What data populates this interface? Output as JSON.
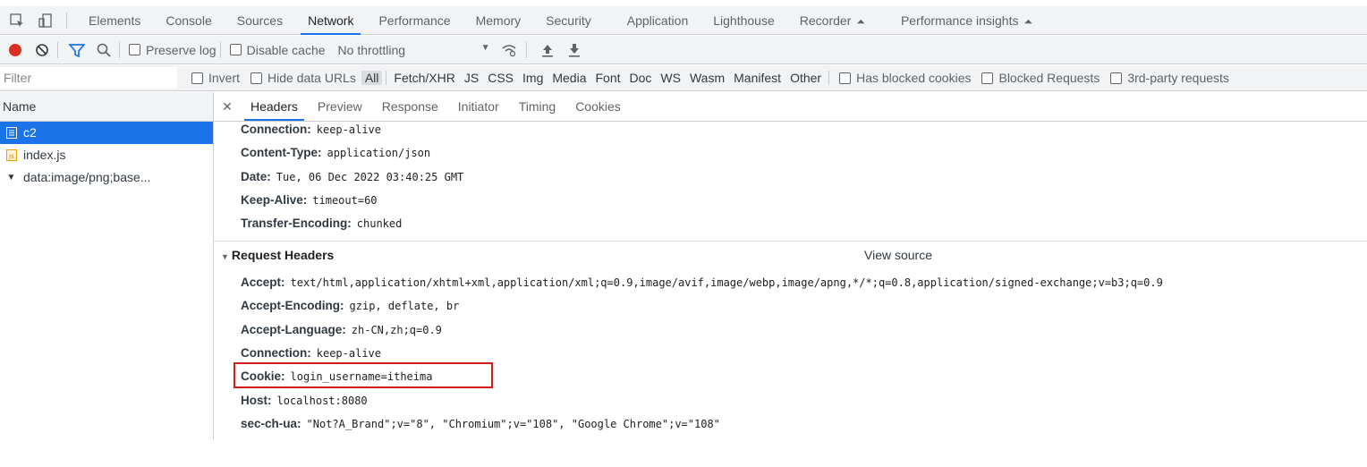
{
  "tabs": [
    "Elements",
    "Console",
    "Sources",
    "Network",
    "Performance",
    "Memory",
    "Security",
    "Application",
    "Lighthouse",
    "Recorder",
    "Performance insights"
  ],
  "active_tab": "Network",
  "toolbar": {
    "preserve_log": "Preserve log",
    "disable_cache": "Disable cache",
    "throttling": "No throttling",
    "record_color": "#d93025"
  },
  "filter": {
    "placeholder": "Filter",
    "invert": "Invert",
    "hide_data_urls": "Hide data URLs",
    "types": [
      "All",
      "Fetch/XHR",
      "JS",
      "CSS",
      "Img",
      "Media",
      "Font",
      "Doc",
      "WS",
      "Wasm",
      "Manifest",
      "Other"
    ],
    "has_blocked_cookies": "Has blocked cookies",
    "blocked_requests": "Blocked Requests",
    "third_party": "3rd-party requests"
  },
  "requests_header": "Name",
  "requests": [
    {
      "name": "c2",
      "icon": "document-icon"
    },
    {
      "name": "index.js",
      "icon": "script-icon"
    },
    {
      "name": "data:image/png;base...",
      "icon": "image-icon"
    }
  ],
  "detail_tabs": [
    "Headers",
    "Preview",
    "Response",
    "Initiator",
    "Timing",
    "Cookies"
  ],
  "response_headers": [
    {
      "name": "Connection:",
      "value": "keep-alive"
    },
    {
      "name": "Content-Type:",
      "value": "application/json"
    },
    {
      "name": "Date:",
      "value": "Tue, 06 Dec 2022 03:40:25 GMT"
    },
    {
      "name": "Keep-Alive:",
      "value": "timeout=60"
    },
    {
      "name": "Transfer-Encoding:",
      "value": "chunked"
    }
  ],
  "request_headers_title": "Request Headers",
  "view_source": "View source",
  "request_headers": [
    {
      "name": "Accept:",
      "value": "text/html,application/xhtml+xml,application/xml;q=0.9,image/avif,image/webp,image/apng,*/*;q=0.8,application/signed-exchange;v=b3;q=0.9"
    },
    {
      "name": "Accept-Encoding:",
      "value": "gzip, deflate, br"
    },
    {
      "name": "Accept-Language:",
      "value": "zh-CN,zh;q=0.9"
    },
    {
      "name": "Connection:",
      "value": "keep-alive"
    },
    {
      "name": "Cookie:",
      "value": "login_username=itheima"
    },
    {
      "name": "Host:",
      "value": "localhost:8080"
    },
    {
      "name": "sec-ch-ua:",
      "value": "\"Not?A_Brand\";v=\"8\", \"Chromium\";v=\"108\", \"Google Chrome\";v=\"108\""
    }
  ]
}
